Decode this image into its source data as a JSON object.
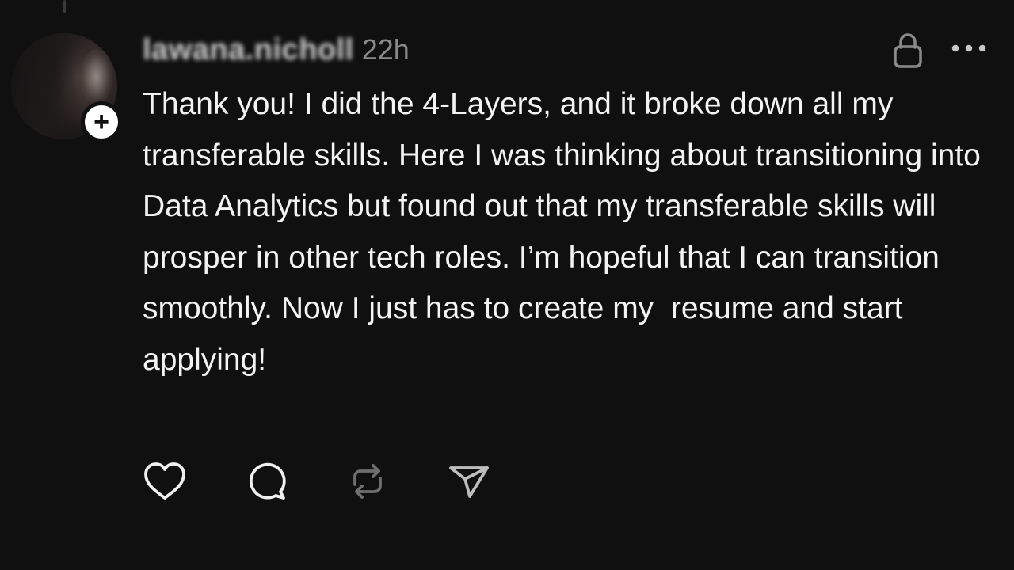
{
  "post": {
    "username": "lawana.nicholl",
    "timestamp": "22h",
    "text": "Thank you! I did the 4-Layers, and it broke down all my transferable skills. Here I was thinking about transitioning into Data Analytics but found out that my transferable skills will prosper in other tech roles. I’m hopeful that I can transition smoothly. Now I just has to create my  resume and start applying!",
    "follow_symbol": "+",
    "icons": {
      "privacy": "lock-icon",
      "menu": "more-icon",
      "like": "heart-icon",
      "reply": "comment-icon",
      "repost": "repost-icon",
      "share": "send-icon"
    }
  },
  "colors": {
    "background": "#101010",
    "text": "#f3f3f3",
    "muted": "#8a8a8a"
  }
}
